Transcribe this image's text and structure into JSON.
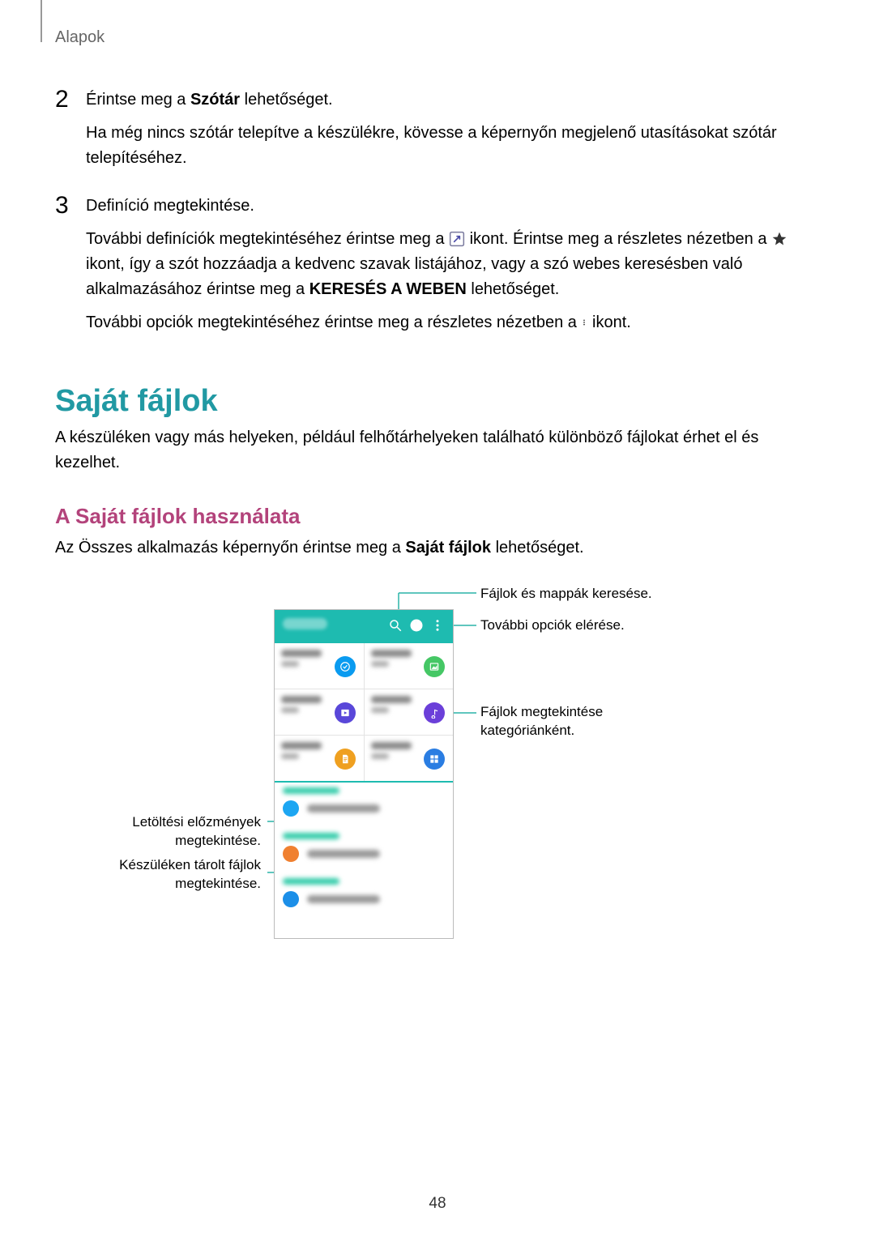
{
  "header": "Alapok",
  "page_number": "48",
  "steps": [
    {
      "num": "2",
      "paras": [
        {
          "spans": [
            {
              "t": "Érintse meg a "
            },
            {
              "t": "Szótár",
              "bold": true
            },
            {
              "t": " lehetőséget."
            }
          ]
        },
        {
          "spans": [
            {
              "t": "Ha még nincs szótár telepítve a készülékre, kövesse a képernyőn megjelenő utasításokat szótár telepítéséhez."
            }
          ]
        }
      ]
    },
    {
      "num": "3",
      "paras": [
        {
          "spans": [
            {
              "t": "Definíció megtekintése."
            }
          ]
        },
        {
          "spans": [
            {
              "t": "További definíciók megtekintéséhez érintse meg a "
            },
            {
              "icon": "expand"
            },
            {
              "t": " ikont. Érintse meg a részletes nézetben a "
            },
            {
              "icon": "star"
            },
            {
              "t": " ikont, így a szót hozzáadja a kedvenc szavak listájához, vagy a szó webes keresésben való alkalmazásához érintse meg a "
            },
            {
              "t": "KERESÉS A WEBEN",
              "bold": true
            },
            {
              "t": " lehetőséget."
            }
          ]
        },
        {
          "spans": [
            {
              "t": "További opciók megtekintéséhez érintse meg a részletes nézetben a "
            },
            {
              "icon": "more"
            },
            {
              "t": " ikont."
            }
          ]
        }
      ]
    }
  ],
  "section": {
    "title": "Saját fájlok",
    "body": "A készüléken vagy más helyeken, például felhőtárhelyeken található különböző fájlokat érhet el és kezelhet.",
    "subsection_title": "A Saját fájlok használata",
    "subsection_body_spans": [
      {
        "t": "Az Összes alkalmazás képernyőn érintse meg a "
      },
      {
        "t": "Saját fájlok",
        "bold": true
      },
      {
        "t": " lehetőséget."
      }
    ]
  },
  "callouts": {
    "search": "Fájlok és mappák keresése.",
    "more": "További opciók elérése.",
    "category": "Fájlok megtekintése\nkategóriánként.",
    "download": "Letöltési előzmények megtekintése.",
    "device": "Készüléken tárolt fájlok\nmegtekintése."
  },
  "figure": {
    "grid_colors": [
      [
        "#0A9BF0",
        "#45C765"
      ],
      [
        "#5947D9",
        "#6B3FD9"
      ],
      [
        "#EFA020",
        "#2A7DE2"
      ]
    ],
    "grid_glyphs": [
      [
        "check",
        "image"
      ],
      [
        "video",
        "music"
      ],
      [
        "doc",
        "apps"
      ]
    ],
    "list": [
      {
        "head_color": "#3CA",
        "icon_color": "#1DA6F2"
      },
      {
        "head_color": "#3CA",
        "icon_color": "#F08030"
      },
      {
        "head_color": "#3CA",
        "icon_color": "#1C8FE8"
      }
    ]
  }
}
